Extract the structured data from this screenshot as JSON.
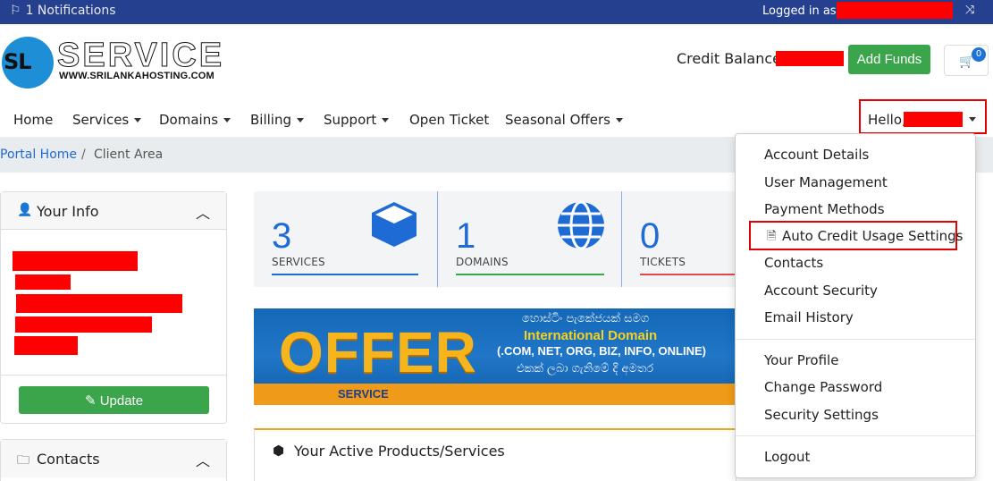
{
  "topbar": {
    "notifications": "1 Notifications",
    "logged_in_label": "Logged in as:"
  },
  "header": {
    "logo_mark": "SL",
    "logo_text": "SERVICE",
    "logo_sub": "WWW.SRILANKAHOSTING.COM",
    "credit_label": "Credit Balance:",
    "add_funds": "Add Funds",
    "cart_count": "0"
  },
  "nav": {
    "home": "Home",
    "services": "Services",
    "domains": "Domains",
    "billing": "Billing",
    "support": "Support",
    "open_ticket": "Open Ticket",
    "seasonal": "Seasonal Offers",
    "hello": "Hello,"
  },
  "breadcrumb": {
    "home": "Portal Home",
    "sep": "/",
    "current": "Client Area"
  },
  "your_info": {
    "title": "Your Info",
    "update": "Update"
  },
  "contacts": {
    "title": "Contacts"
  },
  "stats": [
    {
      "num": "3",
      "label": "SERVICES",
      "color": "#1f6bd6"
    },
    {
      "num": "1",
      "label": "DOMAINS",
      "color": "#3aa54a"
    },
    {
      "num": "0",
      "label": "TICKETS",
      "color": "#e04a4a"
    }
  ],
  "offer": {
    "big": "OFFER",
    "line1": "හොස්ටිං පැකේජයක් සමග",
    "line2": "International Domain",
    "line3": "(.COM, NET, ORG, BIZ, INFO, ONLINE)",
    "line4": "එකක් ලබා ගැනිමේ දි අමතර",
    "logo": "SERVICE"
  },
  "products": {
    "title": "Your Active Products/Services"
  },
  "dropdown": {
    "account_details": "Account Details",
    "user_management": "User Management",
    "payment_methods": "Payment Methods",
    "auto_credit": "Auto Credit Usage Settings",
    "contacts": "Contacts",
    "account_security": "Account Security",
    "email_history": "Email History",
    "your_profile": "Your Profile",
    "change_password": "Change Password",
    "security_settings": "Security Settings",
    "logout": "Logout"
  },
  "colors": {
    "topbar": "#25408f",
    "accent": "#1f6bd6",
    "green": "#3aa54a",
    "highlight": "#e20000"
  }
}
